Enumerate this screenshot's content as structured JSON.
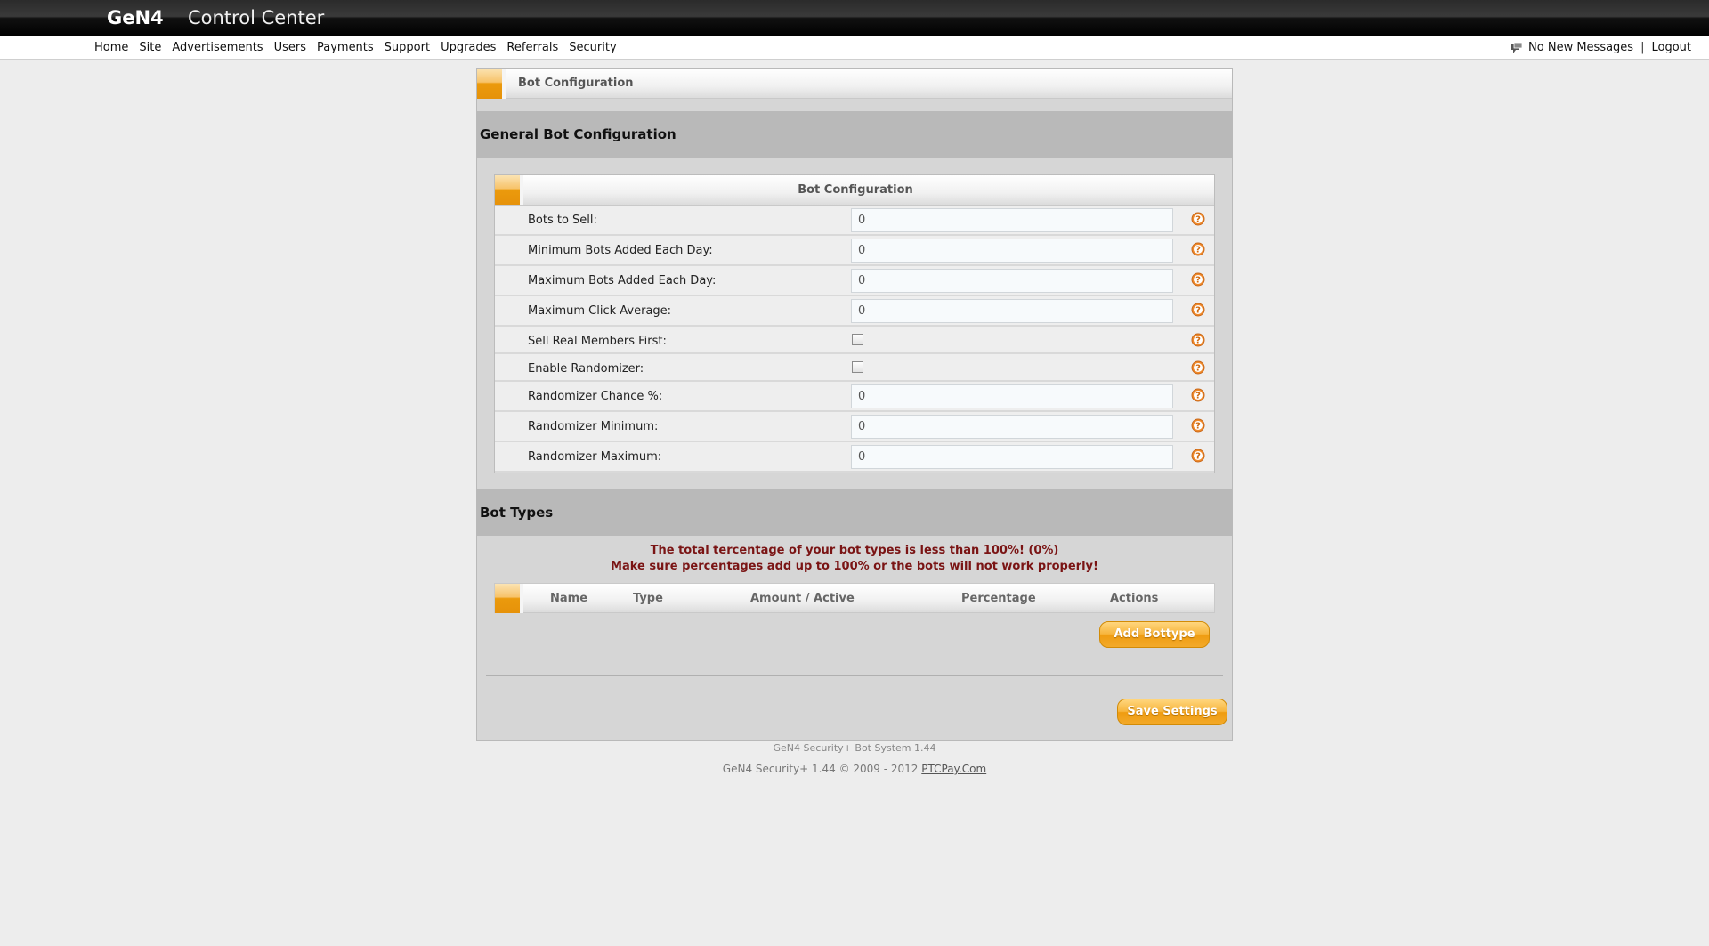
{
  "header": {
    "brand": "GeN4",
    "subtitle": "Control Center"
  },
  "nav": {
    "items": [
      "Home",
      "Site",
      "Advertisements",
      "Users",
      "Payments",
      "Support",
      "Upgrades",
      "Referrals",
      "Security"
    ],
    "messages": "No New Messages",
    "separator": "|",
    "logout": "Logout"
  },
  "panel": {
    "title": "Bot Configuration"
  },
  "general": {
    "section_title": "General Bot Configuration",
    "table_title": "Bot Configuration",
    "fields": [
      {
        "label": "Bots to Sell:",
        "kind": "input",
        "value": "0"
      },
      {
        "label": "Minimum Bots Added Each Day:",
        "kind": "input",
        "value": "0"
      },
      {
        "label": "Maximum Bots Added Each Day:",
        "kind": "input",
        "value": "0"
      },
      {
        "label": "Maximum Click Average:",
        "kind": "input",
        "value": "0"
      },
      {
        "label": "Sell Real Members First:",
        "kind": "checkbox",
        "checked": false
      },
      {
        "label": "Enable Randomizer:",
        "kind": "checkbox",
        "checked": false
      },
      {
        "label": "Randomizer Chance %:",
        "kind": "input",
        "value": "0"
      },
      {
        "label": "Randomizer Minimum:",
        "kind": "input",
        "value": "0"
      },
      {
        "label": "Randomizer Maximum:",
        "kind": "input",
        "value": "0"
      }
    ]
  },
  "bot_types": {
    "section_title": "Bot Types",
    "warning_line1": "The total tercentage of your bot types is less than 100%! (0%)",
    "warning_line2": "Make sure percentages add up to 100% or the bots will not work properly!",
    "columns": [
      "Name",
      "Type",
      "Amount / Active",
      "Percentage",
      "Actions"
    ],
    "add_button": "Add Bottype"
  },
  "save_button": "Save Settings",
  "footer": {
    "version": "GeN4 Security+ Bot System 1.44",
    "copyright": "GeN4 Security+ 1.44 © 2009 - 2012",
    "link": "PTCPay.Com"
  },
  "colors": {
    "accent": "#f0a020",
    "warning": "#7a1414",
    "help_icon": "#f08a2a"
  }
}
